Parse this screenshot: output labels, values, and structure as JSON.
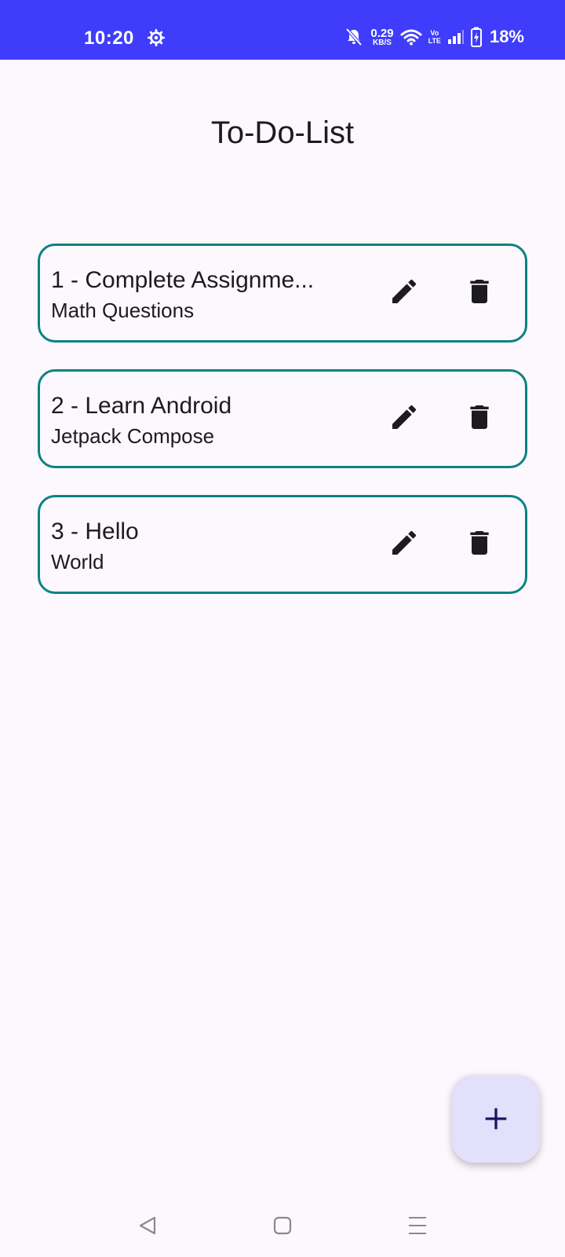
{
  "status_bar": {
    "time": "10:20",
    "net_speed_value": "0.29",
    "net_speed_unit": "KB/S",
    "volte_top": "Vo",
    "volte_bottom": "LTE",
    "battery": "18%"
  },
  "app": {
    "title": "To-Do-List"
  },
  "todos": [
    {
      "name": "1 - Complete Assignme...",
      "description": "Math Questions"
    },
    {
      "name": "2 - Learn Android",
      "description": "Jetpack Compose"
    },
    {
      "name": "3 - Hello",
      "description": "World"
    }
  ],
  "icons": {
    "edit": "pencil-icon",
    "delete": "trash-icon",
    "fab": "plus-icon"
  },
  "colors": {
    "status_bar": "#3f3dfb",
    "card_border": "#0b8282",
    "fab_bg": "#e2e0fa",
    "background": "#fdf8fd"
  }
}
